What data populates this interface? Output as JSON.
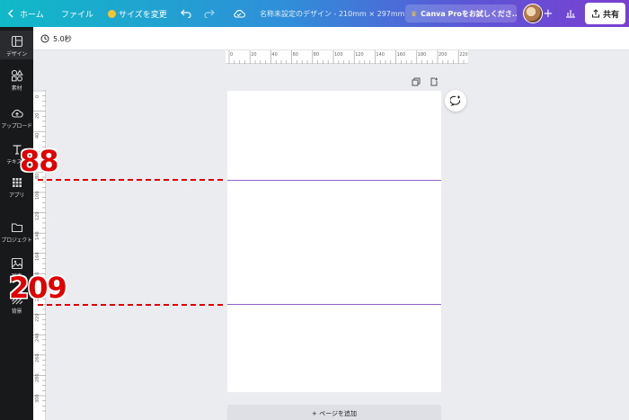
{
  "topbar": {
    "home_label": "ホーム",
    "file_label": "ファイル",
    "resize_label": "サイズを変更",
    "doc_title": "名称未設定のデザイン - 210mm × 297mm",
    "pro_label": "Canva Proをお試しくださ...",
    "share_label": "共有"
  },
  "sidebar": {
    "items": [
      {
        "label": "デザイン",
        "icon": "layout-icon"
      },
      {
        "label": "素材",
        "icon": "shapes-icon"
      },
      {
        "label": "アップロード",
        "icon": "cloud-upload-icon"
      },
      {
        "label": "テキスト",
        "icon": "text-icon"
      },
      {
        "label": "アプリ",
        "icon": "apps-grid-icon"
      },
      {
        "label": "プロジェクト",
        "icon": "folder-icon"
      },
      {
        "label": "写真",
        "icon": "image-icon"
      },
      {
        "label": "背景",
        "icon": "background-icon"
      }
    ]
  },
  "timer": {
    "value": "5.0秒"
  },
  "ruler_top": {
    "ticks": [
      "0",
      "20",
      "40",
      "60",
      "80",
      "100",
      "120",
      "140",
      "160",
      "180",
      "200",
      "220"
    ]
  },
  "ruler_left": {
    "ticks": [
      "0",
      "20",
      "40",
      "60",
      "80",
      "100",
      "120",
      "140",
      "160",
      "180",
      "200",
      "220",
      "240",
      "260",
      "280",
      "300"
    ]
  },
  "annotations": {
    "first": "88",
    "second": "209"
  },
  "canvas": {
    "add_page_label": "+ ページを追加"
  },
  "colors": {
    "guide": "#8f63c9",
    "annotation": "#e00000",
    "sidebar_bg": "#18191b"
  }
}
